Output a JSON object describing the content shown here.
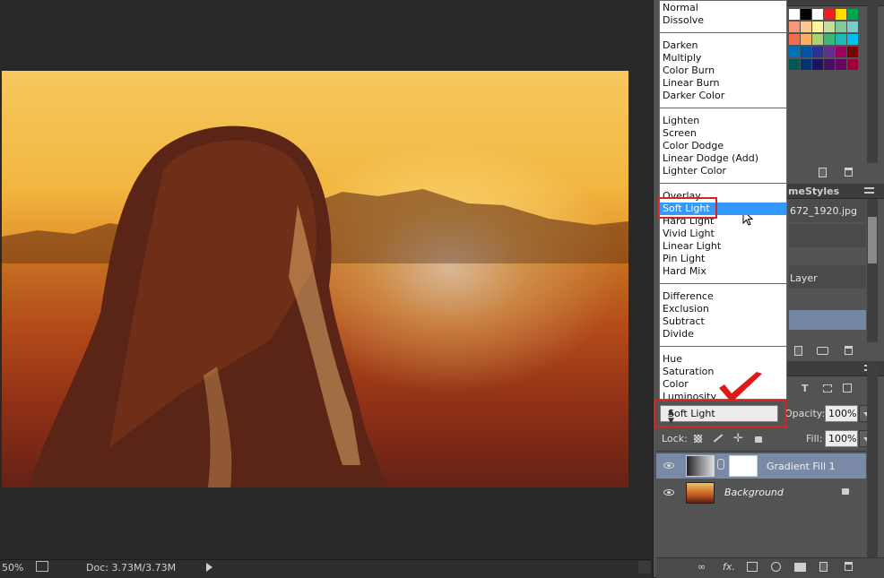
{
  "canvas": {
    "zoom": "50%",
    "doc_size": "Doc: 3.73M/3.73M"
  },
  "swatch_colors": [
    "#ffffff",
    "#000000",
    "#ffffff",
    "#ed1c24",
    "#ffde00",
    "#00a651",
    "#f7977a",
    "#fdc68a",
    "#fff79a",
    "#c4df9b",
    "#82ca9d",
    "#7accc8",
    "#f26c4f",
    "#fbaf5d",
    "#acd372",
    "#3bb878",
    "#1cbbb4",
    "#00bff3",
    "#0072bc",
    "#0054a6",
    "#2e3192",
    "#662d91",
    "#9e005d",
    "#790000",
    "#005952",
    "#003471",
    "#1b1464",
    "#440e62",
    "#630460",
    "#9e0039"
  ],
  "layers_tabs": {
    "partial": "me",
    "styles": "Styles"
  },
  "history": {
    "file_partial": "672_1920.jpg",
    "layer_partial": "Layer"
  },
  "blend_modes": {
    "groups": [
      [
        "Normal",
        "Dissolve"
      ],
      [
        "Darken",
        "Multiply",
        "Color Burn",
        "Linear Burn",
        "Darker Color"
      ],
      [
        "Lighten",
        "Screen",
        "Color Dodge",
        "Linear Dodge (Add)",
        "Lighter Color"
      ],
      [
        "Overlay",
        "Soft Light",
        "Hard Light",
        "Vivid Light",
        "Linear Light",
        "Pin Light",
        "Hard Mix"
      ],
      [
        "Difference",
        "Exclusion",
        "Subtract",
        "Divide"
      ],
      [
        "Hue",
        "Saturation",
        "Color",
        "Luminosity"
      ]
    ],
    "selected": "Soft Light"
  },
  "layers_panel": {
    "blend_value": "Soft Light",
    "opacity_label": "Opacity:",
    "opacity_value": "100%",
    "lock_label": "Lock:",
    "fill_label": "Fill:",
    "fill_value": "100%",
    "layers": [
      {
        "name": "Gradient Fill 1",
        "selected": true
      },
      {
        "name": "Background",
        "selected": false
      }
    ]
  },
  "icons": [
    "eye-icon",
    "link-icon",
    "lock-icon",
    "trash-icon",
    "new-layer-icon",
    "camera-icon",
    "checkmark-annotation-icon",
    "mouse-cursor-icon",
    "fx-icon",
    "mask-icon",
    "folder-icon",
    "adjustment-icon"
  ]
}
